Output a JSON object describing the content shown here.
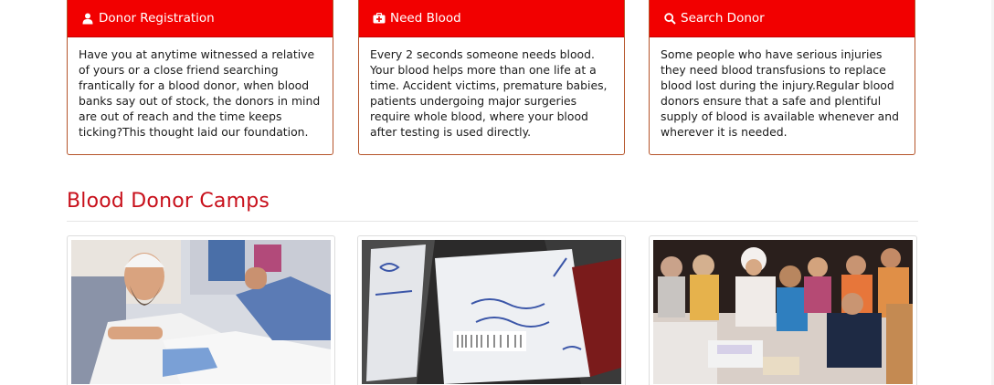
{
  "cards": [
    {
      "icon": "user-icon",
      "title": "Donor Registration",
      "text": "Have you at anytime witnessed a relative of yours or a close friend searching frantically for a blood donor, when blood banks say out of stock, the donors in mind are out of reach and the time keeps ticking?This thought laid our foundation."
    },
    {
      "icon": "medkit-icon",
      "title": "Need Blood",
      "text": "Every 2 seconds someone needs blood. Your blood helps more than one life at a time. Accident victims, premature babies, patients undergoing major surgeries require whole blood, where your blood after testing is used directly."
    },
    {
      "icon": "search-icon",
      "title": "Search Donor",
      "text": "Some people who have serious injuries they need blood transfusions to replace blood lost during the injury.Regular blood donors ensure that a safe and plentiful supply of blood is available whenever and wherever it is needed."
    }
  ],
  "camps": {
    "title": "Blood Donor Camps",
    "photos": [
      {
        "name": "camp-photo-donor-chair"
      },
      {
        "name": "camp-photo-blood-bags"
      },
      {
        "name": "camp-photo-crowd"
      }
    ]
  },
  "colors": {
    "header_red": "#f20000",
    "title_red": "#c8101b",
    "card_border": "#b5542a"
  }
}
